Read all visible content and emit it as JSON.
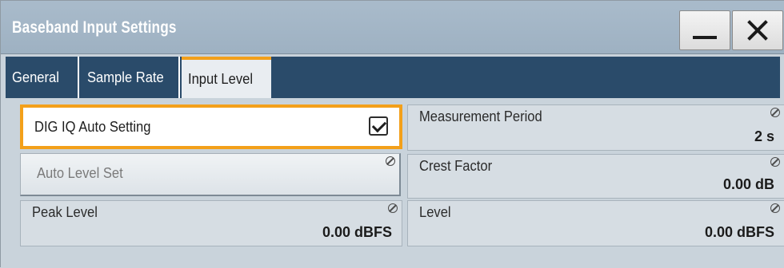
{
  "window": {
    "title": "Baseband Input Settings",
    "controls": {
      "minimize_icon": "minimize-icon",
      "close_icon": "close-icon",
      "close_glyph": "✕"
    }
  },
  "tabs": [
    {
      "label": "General",
      "active": false
    },
    {
      "label": "Sample Rate",
      "active": false
    },
    {
      "label": "Input Level",
      "active": true
    }
  ],
  "settings": {
    "dig_iq_auto": {
      "label": "DIG IQ Auto Setting",
      "checked": true
    },
    "auto_level_set": {
      "label": "Auto Level Set"
    },
    "peak_level": {
      "label": "Peak Level",
      "value": "0.00 dBFS"
    },
    "measurement_period": {
      "label": "Measurement Period",
      "value": "2 s"
    },
    "crest_factor": {
      "label": "Crest Factor",
      "value": "0.00 dB"
    },
    "level": {
      "label": "Level",
      "value": "0.00 dBFS"
    }
  },
  "colors": {
    "accent": "#f3a01a",
    "titlebar": "#a3b6c7",
    "tabbar": "#2a4b6a",
    "background": "#c9d3db"
  }
}
